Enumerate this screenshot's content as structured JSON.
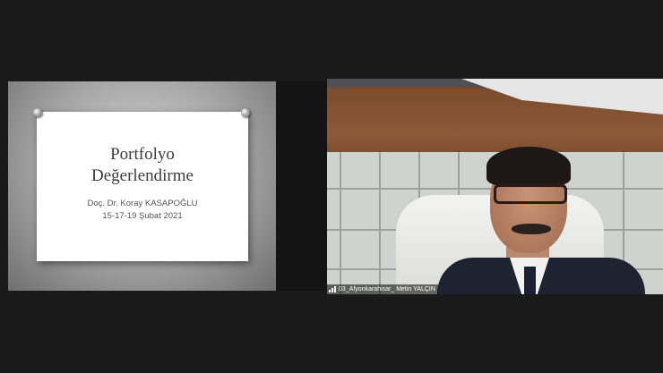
{
  "share": {
    "slide_title_line1": "Portfolyo",
    "slide_title_line2": "Değerlendirme",
    "slide_author": "Doç. Dr. Koray KASAPOĞLU",
    "slide_dates": "15-17-19 Şubat 2021"
  },
  "video": {
    "participant_name": "03_Afyonkarahisar_ Metin YALÇIN",
    "signal_icon": "signal-bars-icon"
  },
  "colors": {
    "background": "#1a1a1a",
    "slide_backdrop": "#a3a3a3",
    "slide_card": "#ffffff",
    "name_bar": "#000000"
  }
}
